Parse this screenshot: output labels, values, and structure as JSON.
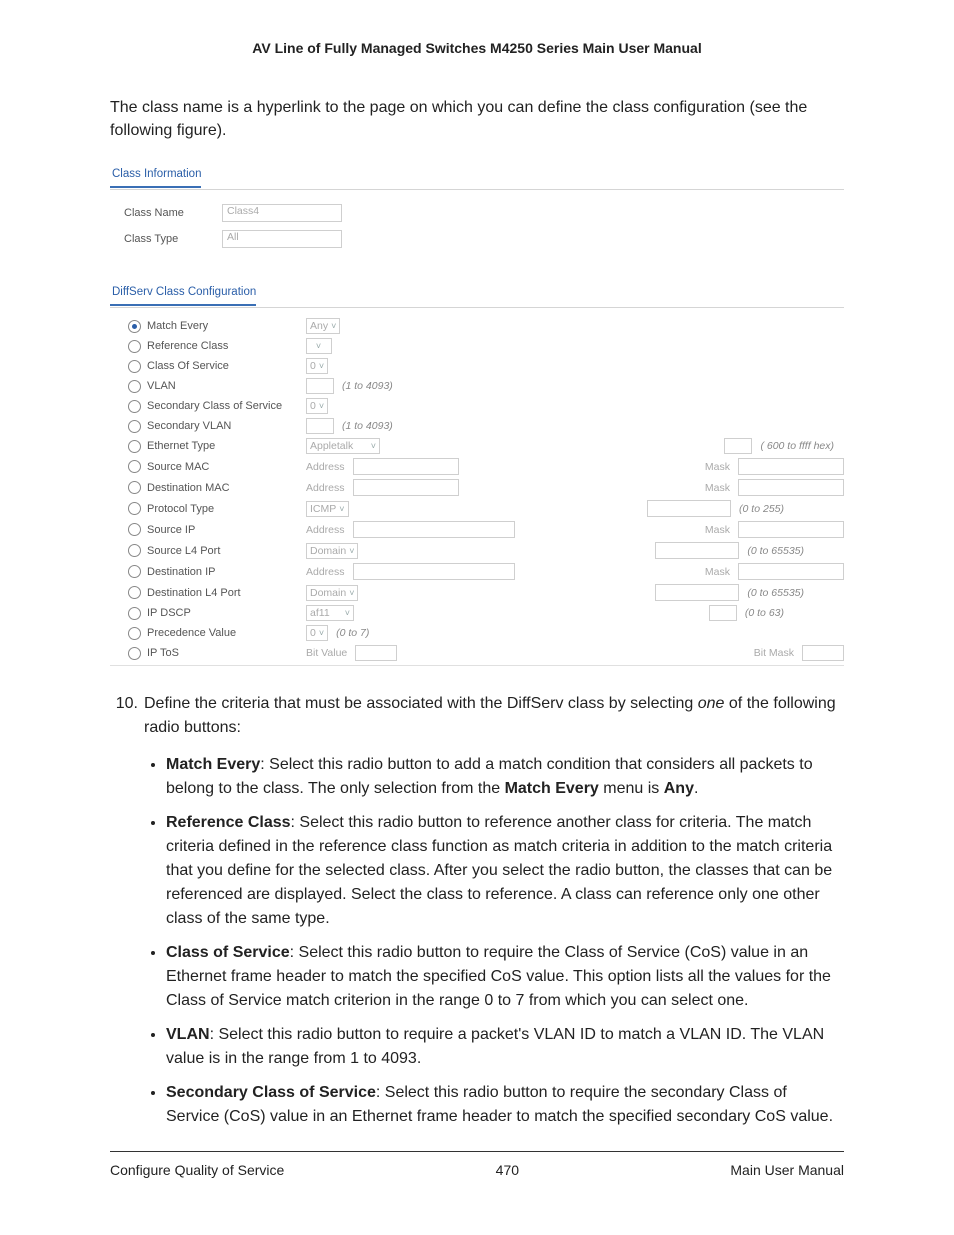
{
  "header": {
    "doc_title": "AV Line of Fully Managed Switches M4250 Series Main User Manual"
  },
  "intro": "The class name is a hyperlink to the page on which you can define the class configuration (see the following figure).",
  "class_info": {
    "title": "Class Information",
    "rows": {
      "name_label": "Class Name",
      "name_value": "Class4",
      "type_label": "Class Type",
      "type_value": "All"
    }
  },
  "diffserv": {
    "title": "DiffServ Class Configuration",
    "rows": [
      {
        "label": "Match Every",
        "selected": true
      },
      {
        "label": "Reference Class"
      },
      {
        "label": "Class Of Service"
      },
      {
        "label": "VLAN"
      },
      {
        "label": "Secondary Class of Service"
      },
      {
        "label": "Secondary VLAN"
      },
      {
        "label": "Ethernet Type"
      },
      {
        "label": "Source MAC"
      },
      {
        "label": "Destination MAC"
      },
      {
        "label": "Protocol Type"
      },
      {
        "label": "Source IP"
      },
      {
        "label": "Source L4 Port"
      },
      {
        "label": "Destination IP"
      },
      {
        "label": "Destination L4 Port"
      },
      {
        "label": "IP DSCP"
      },
      {
        "label": "Precedence Value"
      },
      {
        "label": "IP ToS"
      }
    ],
    "ctrl": {
      "any": "Any",
      "zero": "0",
      "vlan_range": "(1 to 4093)",
      "appletalk": "Appletalk",
      "eth_range": "( 600 to ffff hex)",
      "address": "Address",
      "mask": "Mask",
      "icmp": "ICMP",
      "proto_range": "(0 to 255)",
      "domain": "Domain",
      "l4_range": "(0 to 65535)",
      "l4b_range": "(0 to 65535)",
      "af11": "af11",
      "dscp_range": "(0 to 63)",
      "prec_range": "(0 to 7)",
      "bit_value": "Bit Value",
      "bit_mask": "Bit Mask"
    }
  },
  "step": {
    "number": "10.",
    "text_a": "Define the criteria that must be associated with the DiffServ class by selecting ",
    "text_i": "one",
    "text_b": " of the following radio buttons:"
  },
  "bullets": [
    {
      "b": "Match Every",
      "t": ": Select this radio button to add a match condition that considers all packets to belong to the class. The only selection from the ",
      "b2": "Match Every",
      "t2": " menu is ",
      "b3": "Any",
      "t3": "."
    },
    {
      "b": "Reference Class",
      "t": ": Select this radio button to reference another class for criteria. The match criteria defined in the reference class function as match criteria in addition to the match criteria that you define for the selected class. After you select the radio button, the classes that can be referenced are displayed. Select the class to reference. A class can reference only one other class of the same type."
    },
    {
      "b": "Class of Service",
      "t": ": Select this radio button to require the Class of Service (CoS) value in an Ethernet frame header to match the specified CoS value. This option lists all the values for the Class of Service match criterion in the range 0 to 7 from which you can select one."
    },
    {
      "b": "VLAN",
      "t": ": Select this radio button to require a packet's VLAN ID to match a VLAN ID. The VLAN value is in the range from 1 to 4093."
    },
    {
      "b": "Secondary Class of Service",
      "t": ": Select this radio button to require the secondary Class of Service (CoS) value in an Ethernet frame header to match the specified secondary CoS value."
    }
  ],
  "footer": {
    "left": "Configure Quality of Service",
    "center": "470",
    "right": "Main User Manual"
  }
}
